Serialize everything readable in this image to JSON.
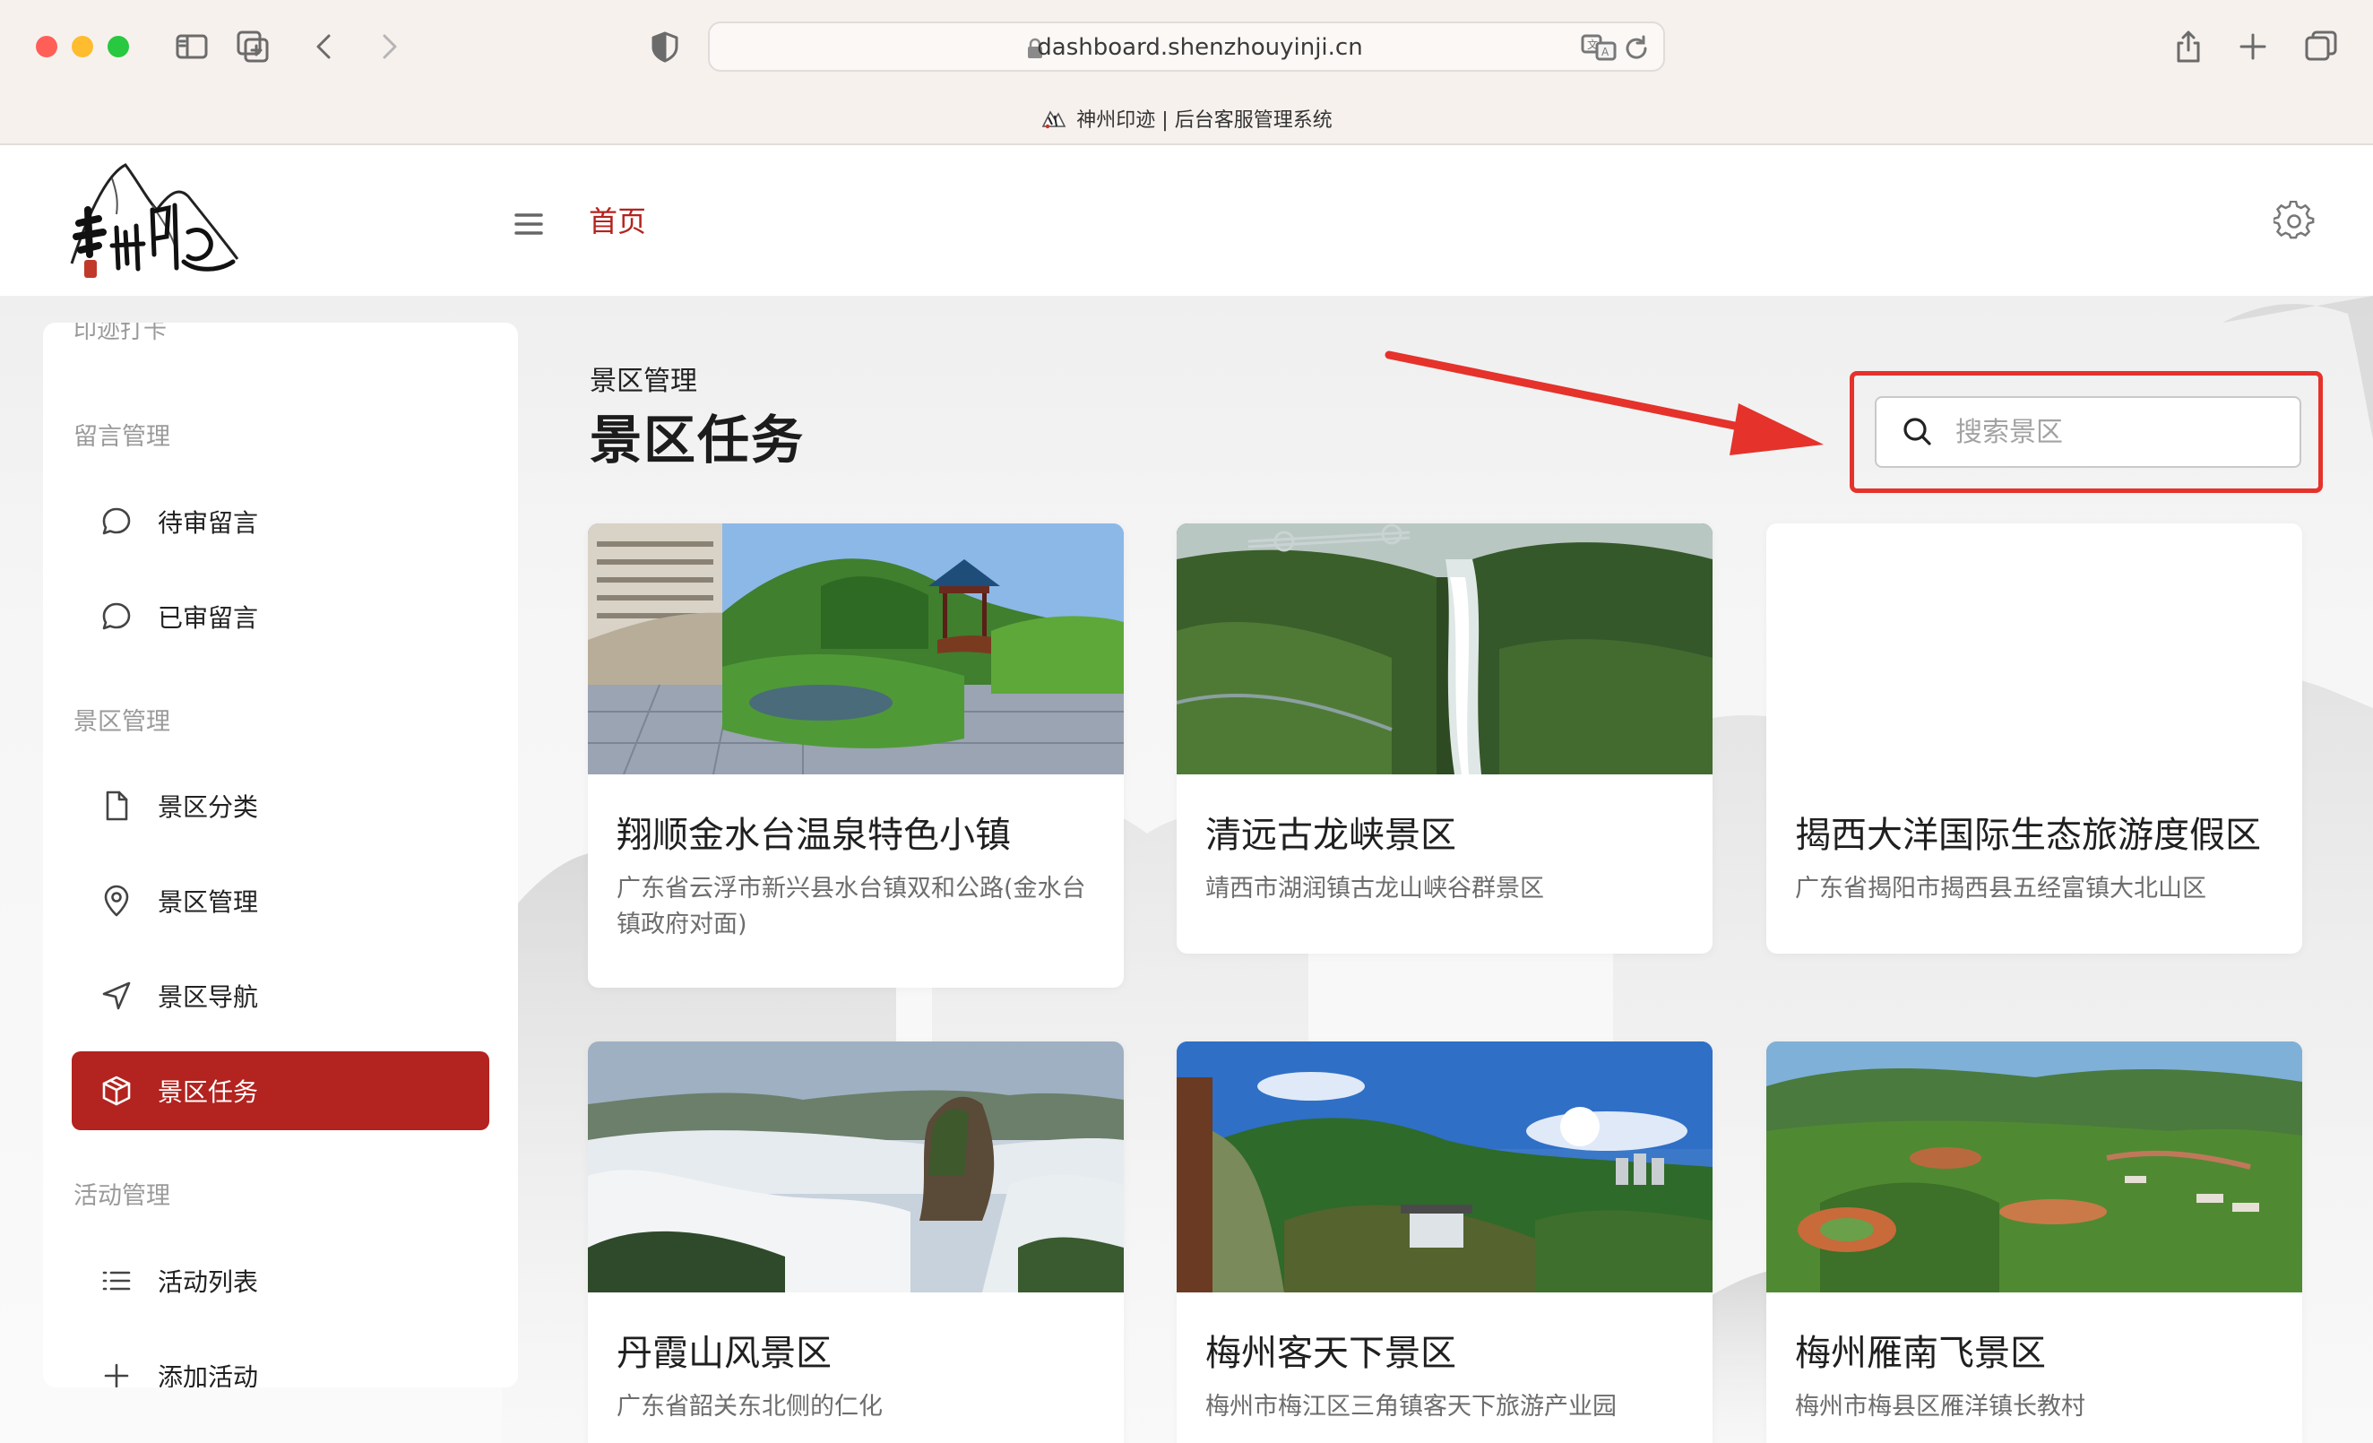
{
  "browser": {
    "url": "dashboard.shenzhouyinji.cn",
    "tab_title": "神州印迹 | 后台客服管理系统"
  },
  "header": {
    "breadcrumb_home": "首页",
    "logo_alt": "神州印迹"
  },
  "sidebar": {
    "cut_item": "印迹打卡",
    "groups": [
      {
        "title": "留言管理",
        "items": [
          {
            "label": "待审留言",
            "icon": "chat-bubble-icon"
          },
          {
            "label": "已审留言",
            "icon": "chat-bubble-icon"
          }
        ]
      },
      {
        "title": "景区管理",
        "items": [
          {
            "label": "景区分类",
            "icon": "document-icon"
          },
          {
            "label": "景区管理",
            "icon": "map-pin-icon"
          },
          {
            "label": "景区导航",
            "icon": "navigation-icon"
          },
          {
            "label": "景区任务",
            "icon": "cube-icon",
            "active": true
          }
        ]
      },
      {
        "title": "活动管理",
        "items": [
          {
            "label": "活动列表",
            "icon": "list-icon"
          },
          {
            "label": "添加活动",
            "icon": "plus-icon"
          }
        ]
      }
    ]
  },
  "main": {
    "breadcrumb": "景区管理",
    "title": "景区任务",
    "search": {
      "placeholder": "搜索景区",
      "value": ""
    },
    "cards": [
      {
        "name": "翔顺金水台温泉特色小镇",
        "address": "广东省云浮市新兴县水台镇双和公路(金水台镇政府对面)",
        "image": "pavilion-garden"
      },
      {
        "name": "清远古龙峡景区",
        "address": "靖西市湖润镇古龙山峡谷群景区",
        "image": "waterfall-gorge"
      },
      {
        "name": "揭西大洋国际生态旅游度假区",
        "address": "广东省揭阳市揭西县五经富镇大北山区",
        "image": "none"
      },
      {
        "name": "丹霞山风景区",
        "address": "广东省韶关东北侧的仁化",
        "image": "misty-peaks"
      },
      {
        "name": "梅州客天下景区",
        "address": "梅州市梅江区三角镇客天下旅游产业园",
        "image": "sunny-valley"
      },
      {
        "name": "梅州雁南飞景区",
        "address": "梅州市梅县区雁洋镇长教村",
        "image": "tea-hills"
      }
    ]
  },
  "colors": {
    "accent": "#b3231f",
    "annotation_red": "#e5322b"
  }
}
